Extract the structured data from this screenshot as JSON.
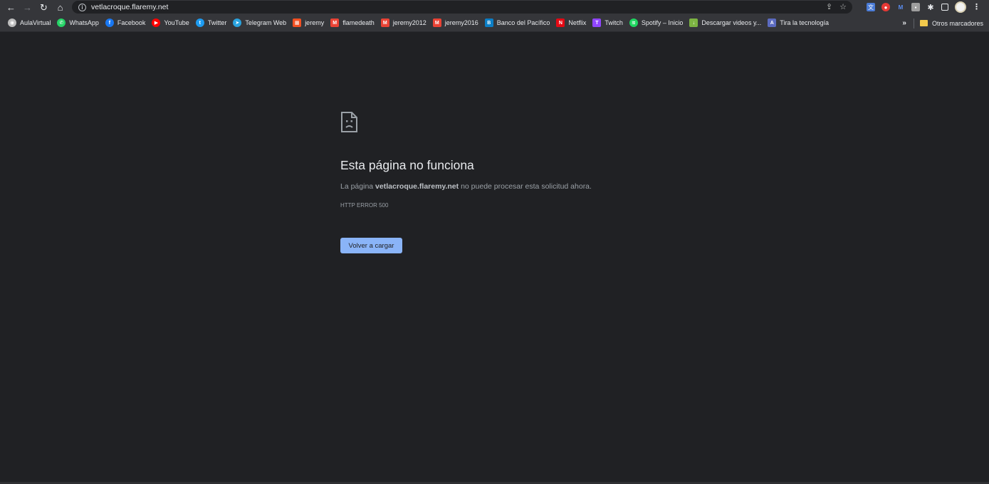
{
  "toolbar": {
    "back_icon": "arrow-left-icon",
    "forward_icon": "arrow-right-icon",
    "reload_icon": "reload-icon",
    "home_icon": "home-icon",
    "url": "vetlacroque.flaremy.net",
    "info_icon": "info-icon"
  },
  "bookmarks": [
    {
      "label": "AulaVirtual",
      "color": "#bdbdbd",
      "glyph": "◉"
    },
    {
      "label": "WhatsApp",
      "color": "#25d366",
      "glyph": "✆"
    },
    {
      "label": "Facebook",
      "color": "#1877f2",
      "glyph": "f"
    },
    {
      "label": "YouTube",
      "color": "#ff0000",
      "glyph": "▶"
    },
    {
      "label": "Twitter",
      "color": "#1d9bf0",
      "glyph": "t"
    },
    {
      "label": "Telegram Web",
      "color": "#2aa3df",
      "glyph": "➤"
    },
    {
      "label": "jeremy",
      "color": "#f25022",
      "glyph": "▦"
    },
    {
      "label": "flamedeath",
      "color": "#ea4335",
      "glyph": "M"
    },
    {
      "label": "jeremy2012",
      "color": "#ea4335",
      "glyph": "M"
    },
    {
      "label": "jeremy2016",
      "color": "#ea4335",
      "glyph": "M"
    },
    {
      "label": "Banco del Pacífico",
      "color": "#0b7ec6",
      "glyph": "B"
    },
    {
      "label": "Netflix",
      "color": "#e50914",
      "glyph": "N"
    },
    {
      "label": "Twitch",
      "color": "#9146ff",
      "glyph": "T"
    },
    {
      "label": "Spotify – Inicio",
      "color": "#1ed760",
      "glyph": "≋"
    },
    {
      "label": "Descargar videos y...",
      "color": "#7cb342",
      "glyph": "↓"
    },
    {
      "label": "Tira la tecnología",
      "color": "#5c6bc0",
      "glyph": "A"
    }
  ],
  "bookmarks_overflow": "»",
  "other_bookmarks": "Otros marcadores",
  "error": {
    "icon": "sad-document-icon",
    "title": "Esta página no funciona",
    "desc_prefix": "La página ",
    "desc_host": "vetlacroque.flaremy.net",
    "desc_suffix": " no puede procesar esta solicitud ahora.",
    "code": "HTTP ERROR 500",
    "reload_label": "Volver a cargar"
  },
  "colors": {
    "background": "#202124",
    "toolbar": "#35363a",
    "button": "#8ab4f8"
  }
}
